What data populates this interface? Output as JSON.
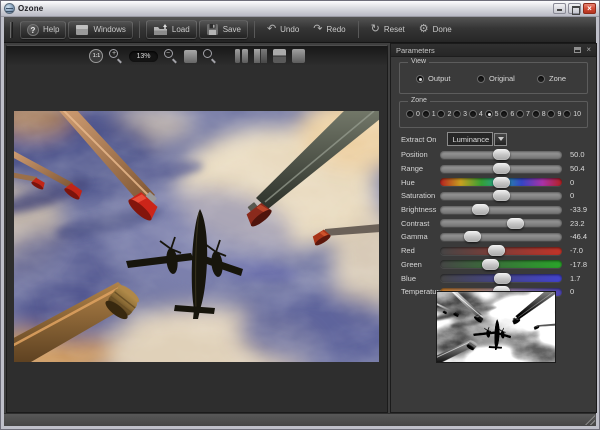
{
  "window": {
    "title": "Ozone",
    "close_glyph": "×"
  },
  "toolbar": {
    "buttons": [
      {
        "id": "help",
        "label": "Help",
        "glyph": "?"
      },
      {
        "id": "windows",
        "label": "Windows"
      },
      {
        "id": "load",
        "label": "Load"
      },
      {
        "id": "save",
        "label": "Save"
      },
      {
        "id": "undo",
        "label": "Undo",
        "glyph": "↶"
      },
      {
        "id": "redo",
        "label": "Redo",
        "glyph": "↷"
      },
      {
        "id": "reset",
        "label": "Reset",
        "glyph": "↻"
      },
      {
        "id": "done",
        "label": "Done",
        "glyph": "⚙"
      }
    ]
  },
  "canvas": {
    "zoom_level": "13%",
    "actual_size_label": "1:1",
    "zoom_in_glyph": "+",
    "zoom_out_glyph": "−"
  },
  "params": {
    "title": "Parameters",
    "close_glyph": "×",
    "view": {
      "label": "View",
      "options": [
        {
          "label": "Output",
          "selected": true
        },
        {
          "label": "Original",
          "selected": false
        },
        {
          "label": "Zone",
          "selected": false
        }
      ]
    },
    "zone": {
      "label": "Zone",
      "selected": "5",
      "options": [
        "0",
        "1",
        "2",
        "3",
        "4",
        "5",
        "6",
        "7",
        "8",
        "9",
        "10"
      ]
    },
    "extract": {
      "label": "Extract On",
      "value": "Luminance"
    },
    "sliders": [
      {
        "label": "Position",
        "value": "50.0",
        "pos": "50%",
        "track": "gray"
      },
      {
        "label": "Range",
        "value": "50.4",
        "pos": "50.2%",
        "track": "gray"
      },
      {
        "label": "Hue",
        "value": "0",
        "pos": "50%",
        "track": "hue"
      },
      {
        "label": "Saturation",
        "value": "0",
        "pos": "50%",
        "track": "gray"
      },
      {
        "label": "Brightness",
        "value": "-33.9",
        "pos": "33%",
        "track": "gray"
      },
      {
        "label": "Contrast",
        "value": "23.2",
        "pos": "61.6%",
        "track": "gray"
      },
      {
        "label": "Gamma",
        "value": "-46.4",
        "pos": "26.8%",
        "track": "gray"
      },
      {
        "label": "Red",
        "value": "-7.0",
        "pos": "46.5%",
        "track": "red"
      },
      {
        "label": "Green",
        "value": "-17.8",
        "pos": "41.1%",
        "track": "green"
      },
      {
        "label": "Blue",
        "value": "1.7",
        "pos": "50.9%",
        "track": "blue"
      },
      {
        "label": "Temperature",
        "value": "0",
        "pos": "50%",
        "track": "temp"
      }
    ],
    "colors": {
      "accent_red": "#cc2519",
      "slider_handle": "#d8d8d8",
      "panel_bg": "#3a3a3a"
    }
  }
}
